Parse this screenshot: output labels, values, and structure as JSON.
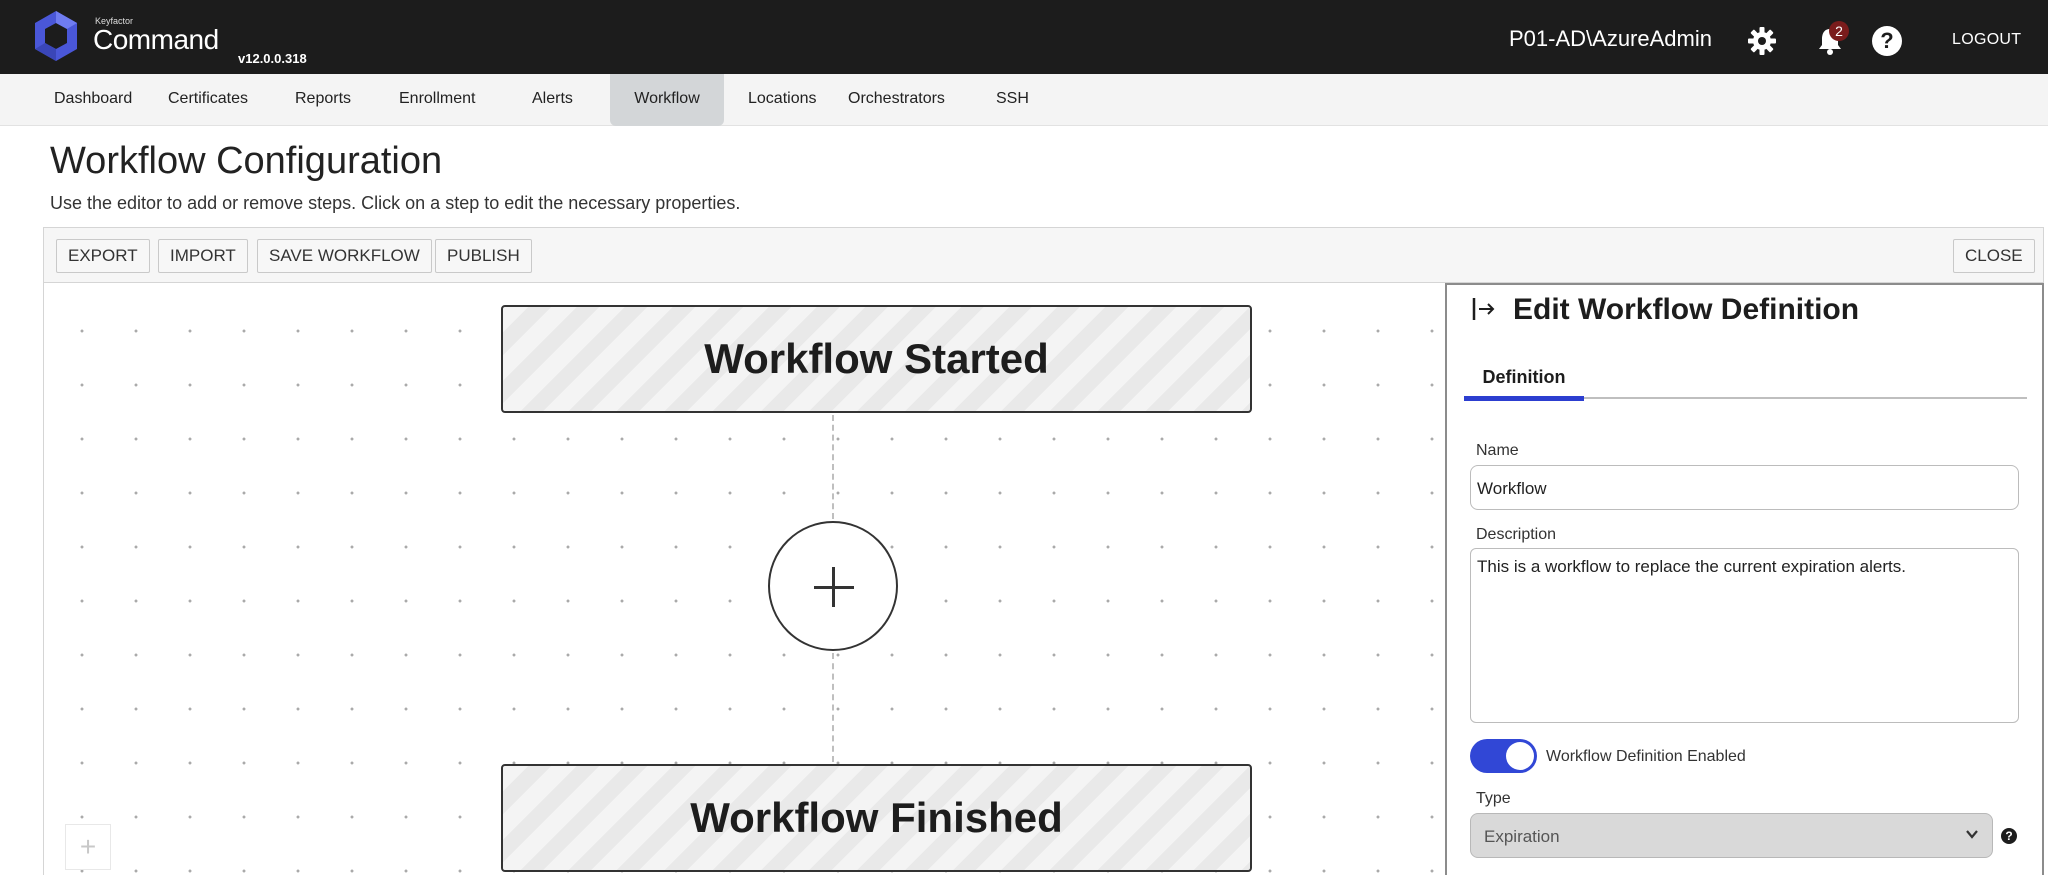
{
  "app": {
    "brand_small": "Keyfactor",
    "brand": "Command",
    "version": "v12.0.0.318",
    "user": "P01-AD\\AzureAdmin",
    "notifications_count": "2",
    "logout_label": "LOGOUT",
    "accent_color": "#3147d6"
  },
  "nav": {
    "items": [
      {
        "label": "Dashboard"
      },
      {
        "label": "Certificates"
      },
      {
        "label": "Reports"
      },
      {
        "label": "Enrollment"
      },
      {
        "label": "Alerts"
      },
      {
        "label": "Workflow",
        "active": true
      },
      {
        "label": "Locations"
      },
      {
        "label": "Orchestrators"
      },
      {
        "label": "SSH"
      }
    ]
  },
  "page": {
    "title": "Workflow Configuration",
    "subtitle": "Use the editor to add or remove steps. Click on a step to edit the necessary properties."
  },
  "toolbar": {
    "export_label": "EXPORT",
    "import_label": "IMPORT",
    "save_label": "SAVE WORKFLOW",
    "publish_label": "PUBLISH",
    "close_label": "CLOSE"
  },
  "canvas": {
    "start_step": "Workflow Started",
    "finish_step": "Workflow Finished",
    "zoom_in_symbol": "+"
  },
  "panel": {
    "title": "Edit Workflow Definition",
    "tab_definition": "Definition",
    "name_label": "Name",
    "name_value": "Workflow",
    "description_label": "Description",
    "description_value": "This is a workflow to replace the current expiration alerts.",
    "enabled_label": "Workflow Definition Enabled",
    "enabled": true,
    "type_label": "Type",
    "type_value": "Expiration"
  }
}
